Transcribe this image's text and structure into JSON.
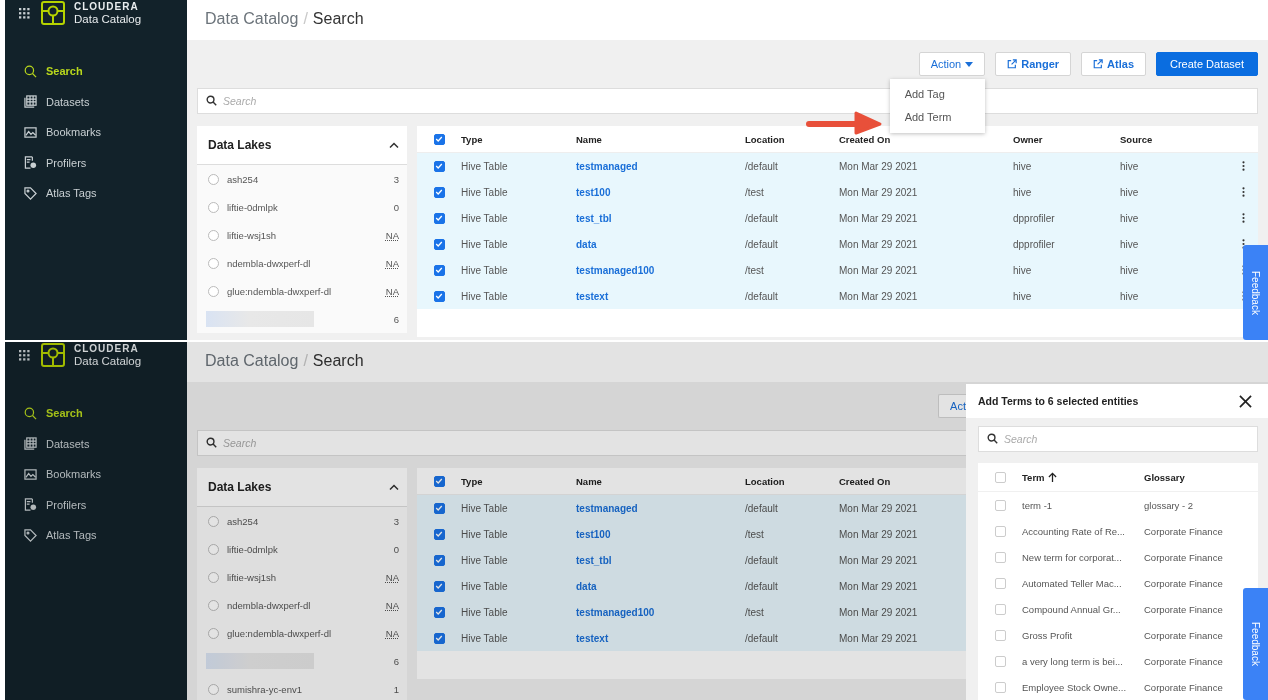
{
  "screens": [
    {
      "sidebar": {
        "brand": "CLOUDERA",
        "product": "Data Catalog",
        "items": [
          {
            "label": "Search",
            "selected": true
          },
          {
            "label": "Datasets",
            "selected": false
          },
          {
            "label": "Bookmarks",
            "selected": false
          },
          {
            "label": "Profilers",
            "selected": false
          },
          {
            "label": "Atlas Tags",
            "selected": false
          }
        ]
      },
      "breadcrumb": {
        "parent": "Data Catalog",
        "separator": "/",
        "current": "Search"
      },
      "buttons": [
        {
          "label": "Action",
          "kind": "dropdown"
        },
        {
          "label": "Ranger",
          "kind": "link"
        },
        {
          "label": "Atlas",
          "kind": "link"
        },
        {
          "label": "Create Dataset",
          "kind": "primary"
        }
      ],
      "action_menu": {
        "items": [
          "Add Tag",
          "Add Term"
        ]
      },
      "annotation": {
        "kind": "arrow"
      },
      "search": {
        "placeholder": "Search"
      },
      "data_lakes": {
        "title": "Data Lakes",
        "expanded": true,
        "items": [
          {
            "kind": "lake",
            "name": "ash254",
            "count": "3",
            "selected": false
          },
          {
            "kind": "lake",
            "name": "liftie-0dmlpk",
            "count": "0",
            "selected": false
          },
          {
            "kind": "lake",
            "name": "liftie-wsj1sh",
            "count": "NA",
            "selected": false
          },
          {
            "kind": "lake",
            "name": "ndembla-dwxperf-dl",
            "count": "NA",
            "selected": false
          },
          {
            "kind": "lake",
            "name": "glue:ndembla-dwxperf-dl",
            "count": "NA",
            "selected": false
          },
          {
            "kind": "redacted",
            "count": "6"
          }
        ]
      },
      "table": {
        "all_checked": true,
        "columns": [
          "Type",
          "Name",
          "Location",
          "Created On",
          "Owner",
          "Source"
        ],
        "row_menu": true,
        "rows": [
          {
            "checked": true,
            "cells": [
              "Hive Table",
              "testmanaged",
              "/default",
              "Mon Mar 29 2021",
              "hive",
              "hive"
            ]
          },
          {
            "checked": true,
            "cells": [
              "Hive Table",
              "test100",
              "/test",
              "Mon Mar 29 2021",
              "hive",
              "hive"
            ]
          },
          {
            "checked": true,
            "cells": [
              "Hive Table",
              "test_tbl",
              "/default",
              "Mon Mar 29 2021",
              "dpprofiler",
              "hive"
            ]
          },
          {
            "checked": true,
            "cells": [
              "Hive Table",
              "data",
              "/default",
              "Mon Mar 29 2021",
              "dpprofiler",
              "hive"
            ]
          },
          {
            "checked": true,
            "cells": [
              "Hive Table",
              "testmanaged100",
              "/test",
              "Mon Mar 29 2021",
              "hive",
              "hive"
            ]
          },
          {
            "checked": true,
            "cells": [
              "Hive Table",
              "testext",
              "/default",
              "Mon Mar 29 2021",
              "hive",
              "hive"
            ]
          }
        ]
      },
      "feedback": "Feedback"
    },
    {
      "sidebar": {
        "brand": "CLOUDERA",
        "product": "Data Catalog",
        "items": [
          {
            "label": "Search",
            "selected": true
          },
          {
            "label": "Datasets",
            "selected": false
          },
          {
            "label": "Bookmarks",
            "selected": false
          },
          {
            "label": "Profilers",
            "selected": false
          },
          {
            "label": "Atlas Tags",
            "selected": false
          }
        ]
      },
      "breadcrumb": {
        "parent": "Data Catalog",
        "separator": "/",
        "current": "Search"
      },
      "buttons": [
        {
          "label": "Act",
          "kind": "cut"
        }
      ],
      "search": {
        "placeholder": "Search"
      },
      "data_lakes": {
        "title": "Data Lakes",
        "expanded": true,
        "items": [
          {
            "kind": "lake",
            "name": "ash254",
            "count": "3",
            "selected": false
          },
          {
            "kind": "lake",
            "name": "liftie-0dmlpk",
            "count": "0",
            "selected": false
          },
          {
            "kind": "lake",
            "name": "liftie-wsj1sh",
            "count": "NA",
            "selected": false
          },
          {
            "kind": "lake",
            "name": "ndembla-dwxperf-dl",
            "count": "NA",
            "selected": false
          },
          {
            "kind": "lake",
            "name": "glue:ndembla-dwxperf-dl",
            "count": "NA",
            "selected": false
          },
          {
            "kind": "redacted",
            "count": "6"
          },
          {
            "kind": "lake",
            "name": "sumishra-yc-env1",
            "count": "1",
            "selected": false
          }
        ]
      },
      "table": {
        "all_checked": true,
        "columns": [
          "Type",
          "Name",
          "Location",
          "Created On"
        ],
        "row_menu": false,
        "rows": [
          {
            "checked": true,
            "cells": [
              "Hive Table",
              "testmanaged",
              "/default",
              "Mon Mar 29 2021"
            ]
          },
          {
            "checked": true,
            "cells": [
              "Hive Table",
              "test100",
              "/test",
              "Mon Mar 29 2021"
            ]
          },
          {
            "checked": true,
            "cells": [
              "Hive Table",
              "test_tbl",
              "/default",
              "Mon Mar 29 2021"
            ]
          },
          {
            "checked": true,
            "cells": [
              "Hive Table",
              "data",
              "/default",
              "Mon Mar 29 2021"
            ]
          },
          {
            "checked": true,
            "cells": [
              "Hive Table",
              "testmanaged100",
              "/test",
              "Mon Mar 29 2021"
            ]
          },
          {
            "checked": true,
            "cells": [
              "Hive Table",
              "testext",
              "/default",
              "Mon Mar 29 2021"
            ]
          }
        ]
      },
      "terms_panel": {
        "title": "Add Terms to 6 selected entities",
        "search_placeholder": "Search",
        "all_checked": false,
        "columns": [
          "Term",
          "Glossary"
        ],
        "rows": [
          {
            "checked": false,
            "term": "term -1",
            "glossary": "glossary - 2"
          },
          {
            "checked": false,
            "term": "Accounting Rate of Re...",
            "glossary": "Corporate Finance"
          },
          {
            "checked": false,
            "term": "New term for corporat...",
            "glossary": "Corporate Finance"
          },
          {
            "checked": false,
            "term": "Automated Teller Mac...",
            "glossary": "Corporate Finance"
          },
          {
            "checked": false,
            "term": "Compound Annual Gr...",
            "glossary": "Corporate Finance"
          },
          {
            "checked": false,
            "term": "Gross Profit",
            "glossary": "Corporate Finance"
          },
          {
            "checked": false,
            "term": "a very long term is bei...",
            "glossary": "Corporate Finance"
          },
          {
            "checked": false,
            "term": "Employee Stock Owne...",
            "glossary": "Corporate Finance"
          }
        ]
      },
      "feedback": "Feedback"
    }
  ]
}
